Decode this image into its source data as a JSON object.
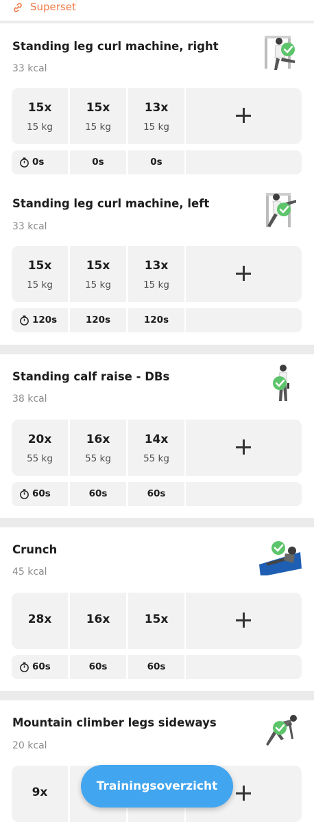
{
  "superset": {
    "label": "Superset",
    "icon": "link-icon"
  },
  "exercises": [
    {
      "title": "Standing leg curl machine, right",
      "kcal": "33 kcal",
      "sets": [
        {
          "reps": "15x",
          "weight": "15 kg"
        },
        {
          "reps": "15x",
          "weight": "15 kg"
        },
        {
          "reps": "13x",
          "weight": "15 kg"
        }
      ],
      "rests": [
        "0s",
        "0s",
        "0s"
      ]
    },
    {
      "title": "Standing leg curl machine, left",
      "kcal": "33 kcal",
      "sets": [
        {
          "reps": "15x",
          "weight": "15 kg"
        },
        {
          "reps": "15x",
          "weight": "15 kg"
        },
        {
          "reps": "13x",
          "weight": "15 kg"
        }
      ],
      "rests": [
        "120s",
        "120s",
        "120s"
      ]
    },
    {
      "title": "Standing calf raise - DBs",
      "kcal": "38 kcal",
      "sets": [
        {
          "reps": "20x",
          "weight": "55 kg"
        },
        {
          "reps": "16x",
          "weight": "55 kg"
        },
        {
          "reps": "14x",
          "weight": "55 kg"
        }
      ],
      "rests": [
        "60s",
        "60s",
        "60s"
      ]
    },
    {
      "title": "Crunch",
      "kcal": "45 kcal",
      "sets": [
        {
          "reps": "28x"
        },
        {
          "reps": "16x"
        },
        {
          "reps": "15x"
        }
      ],
      "rests": [
        "60s",
        "60s",
        "60s"
      ]
    },
    {
      "title": "Mountain climber legs sideways",
      "kcal": "20 kcal",
      "sets": [
        {
          "reps": "9x"
        }
      ]
    }
  ],
  "fab": {
    "label": "Trainingsoverzicht"
  },
  "colors": {
    "accent": "#f07a45",
    "primary": "#42a5f0",
    "check": "#5cc46a",
    "cell": "#f2f2f2"
  }
}
